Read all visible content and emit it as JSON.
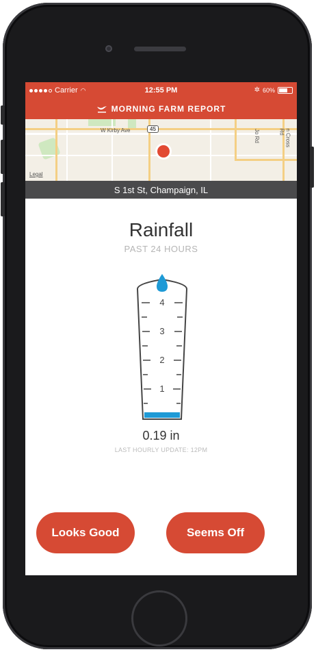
{
  "status_bar": {
    "carrier": "Carrier",
    "time": "12:55 PM",
    "battery": "60%"
  },
  "header": {
    "title": "MORNING FARM REPORT"
  },
  "map": {
    "street_label": "W Kirby Ave",
    "route_shield": "45",
    "road_right_1": "Jo Rd",
    "road_right_2": "n Cross Rd",
    "legal": "Legal"
  },
  "location": "S 1st St, Champaign, IL",
  "rainfall": {
    "title": "Rainfall",
    "subtitle": "PAST 24 HOURS",
    "gauge_ticks": [
      "4",
      "3",
      "2",
      "1"
    ],
    "value_in": 0.19,
    "reading": "0.19 in",
    "last_update": "LAST HOURLY UPDATE: 12PM"
  },
  "buttons": {
    "looks_good": "Looks Good",
    "seems_off": "Seems Off"
  },
  "colors": {
    "accent": "#d64a34",
    "water": "#1e9ad6",
    "location_bar": "#4a4a4c"
  }
}
